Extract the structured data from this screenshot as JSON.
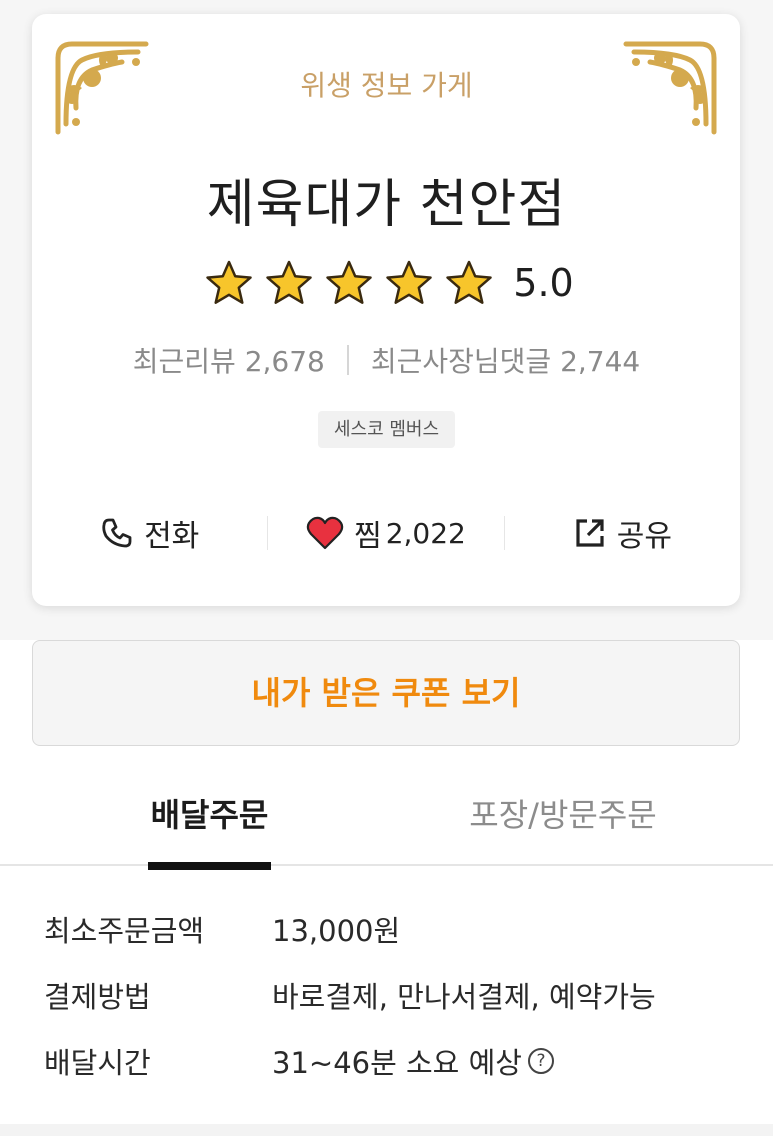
{
  "header": {
    "hygiene_label": "위생 정보 가게",
    "store_name": "제육대가 천안점",
    "rating": "5.0",
    "rating_stars": 5,
    "recent_reviews": "최근리뷰 2,678",
    "recent_owner_replies": "최근사장님댓글 2,744",
    "member_badge": "세스코 멤버스"
  },
  "actions": {
    "call_label": "전화",
    "like_label": "찜",
    "like_count": "2,022",
    "share_label": "공유"
  },
  "coupon": {
    "label": "내가 받은 쿠폰 보기"
  },
  "tabs": [
    {
      "label": "배달주문",
      "active": true
    },
    {
      "label": "포장/방문주문",
      "active": false
    }
  ],
  "info": [
    {
      "label": "최소주문금액",
      "value": "13,000원"
    },
    {
      "label": "결제방법",
      "value": "바로결제, 만나서결제, 예약가능"
    },
    {
      "label": "배달시간",
      "value": "31~46분 소요 예상"
    }
  ],
  "help_icon_glyph": "?",
  "colors": {
    "accent_orange": "#f08a0e",
    "gold": "#c9a067",
    "heart_red": "#e8313f",
    "star_yellow": "#f7c52b"
  },
  "icons": [
    "ornament-corner-icon",
    "star-icon",
    "phone-icon",
    "heart-icon",
    "share-icon",
    "help-icon"
  ]
}
